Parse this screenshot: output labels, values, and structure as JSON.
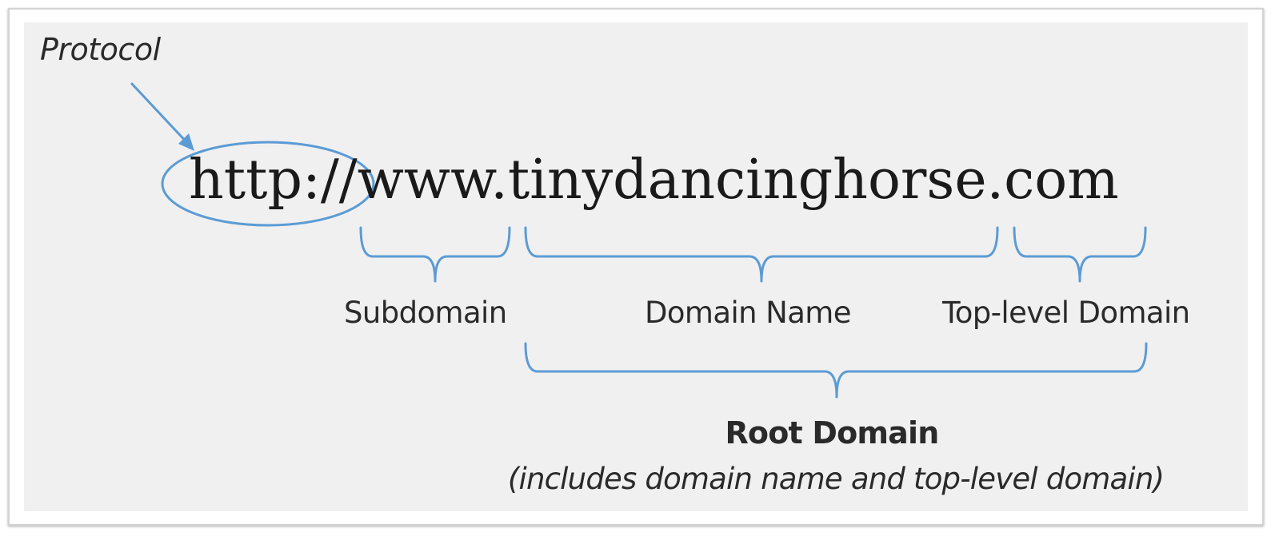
{
  "diagram": {
    "protocol_label": "Protocol",
    "url": "http://www.tinydancinghorse.com",
    "subdomain_label": "Subdomain",
    "domain_name_label": "Domain Name",
    "tld_label": "Top-level Domain",
    "root_domain_label": "Root Domain",
    "root_domain_note": "(includes domain name and top-level domain)",
    "accent_color": "#5b9bd5"
  }
}
